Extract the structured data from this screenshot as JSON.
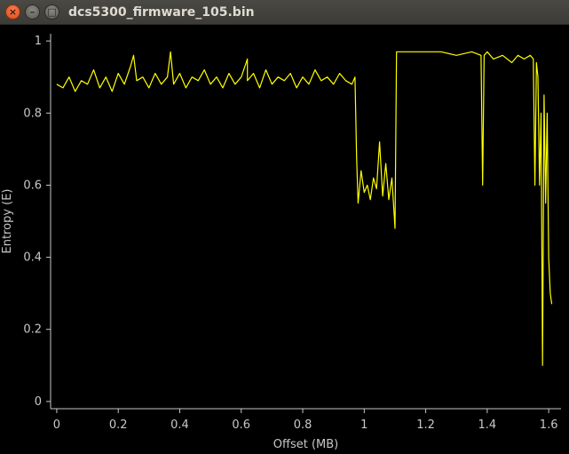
{
  "window": {
    "title": "dcs5300_firmware_105.bin",
    "close_glyph": "×",
    "minimize_glyph": "–",
    "maximize_glyph": "□"
  },
  "colors": {
    "background": "#000000",
    "series": "#ffff00",
    "axis": "#c8c8c8"
  },
  "chart_data": {
    "type": "line",
    "title": "",
    "xlabel": "Offset (MB)",
    "ylabel": "Entropy (E)",
    "xlim": [
      -0.02,
      1.64
    ],
    "ylim": [
      -0.02,
      1.02
    ],
    "xticks": [
      0,
      0.2,
      0.4,
      0.6,
      0.8,
      1,
      1.2,
      1.4,
      1.6
    ],
    "xtick_labels": [
      "0",
      "0.2",
      "0.4",
      "0.6",
      "0.8",
      "1",
      "1.2",
      "1.4",
      "1.6"
    ],
    "yticks": [
      0,
      0.2,
      0.4,
      0.6,
      0.8,
      1
    ],
    "ytick_labels": [
      "0",
      "0.2",
      "0.4",
      "0.6",
      "0.8",
      "1"
    ],
    "grid": false,
    "series": [
      {
        "x": [
          0.0,
          0.02,
          0.04,
          0.06,
          0.08,
          0.1,
          0.12,
          0.14,
          0.16,
          0.18,
          0.2,
          0.22,
          0.24,
          0.25,
          0.26,
          0.28,
          0.3,
          0.32,
          0.34,
          0.36,
          0.37,
          0.38,
          0.4,
          0.42,
          0.44,
          0.46,
          0.48,
          0.5,
          0.52,
          0.54,
          0.56,
          0.58,
          0.6,
          0.62,
          0.62,
          0.64,
          0.66,
          0.68,
          0.7,
          0.72,
          0.74,
          0.76,
          0.78,
          0.8,
          0.82,
          0.84,
          0.86,
          0.88,
          0.9,
          0.92,
          0.94,
          0.96,
          0.97,
          0.975,
          0.98,
          0.99,
          1.0,
          1.01,
          1.02,
          1.03,
          1.04,
          1.05,
          1.06,
          1.07,
          1.08,
          1.09,
          1.1,
          1.105,
          1.11,
          1.15,
          1.2,
          1.25,
          1.3,
          1.35,
          1.38,
          1.385,
          1.39,
          1.4,
          1.42,
          1.45,
          1.48,
          1.5,
          1.52,
          1.54,
          1.55,
          1.555,
          1.56,
          1.565,
          1.57,
          1.575,
          1.58,
          1.585,
          1.59,
          1.595,
          1.6,
          1.605,
          1.61
        ],
        "y": [
          0.88,
          0.87,
          0.9,
          0.86,
          0.89,
          0.88,
          0.92,
          0.87,
          0.9,
          0.86,
          0.91,
          0.88,
          0.93,
          0.96,
          0.89,
          0.9,
          0.87,
          0.91,
          0.88,
          0.9,
          0.97,
          0.88,
          0.91,
          0.87,
          0.9,
          0.89,
          0.92,
          0.88,
          0.9,
          0.87,
          0.91,
          0.88,
          0.9,
          0.95,
          0.89,
          0.91,
          0.87,
          0.92,
          0.88,
          0.9,
          0.89,
          0.91,
          0.87,
          0.9,
          0.88,
          0.92,
          0.89,
          0.9,
          0.88,
          0.91,
          0.89,
          0.88,
          0.9,
          0.68,
          0.55,
          0.64,
          0.58,
          0.6,
          0.56,
          0.62,
          0.59,
          0.72,
          0.57,
          0.66,
          0.56,
          0.62,
          0.48,
          0.97,
          0.97,
          0.97,
          0.97,
          0.97,
          0.96,
          0.97,
          0.96,
          0.6,
          0.96,
          0.97,
          0.95,
          0.96,
          0.94,
          0.96,
          0.95,
          0.96,
          0.95,
          0.6,
          0.94,
          0.9,
          0.6,
          0.8,
          0.1,
          0.85,
          0.55,
          0.8,
          0.4,
          0.3,
          0.27
        ]
      }
    ]
  }
}
